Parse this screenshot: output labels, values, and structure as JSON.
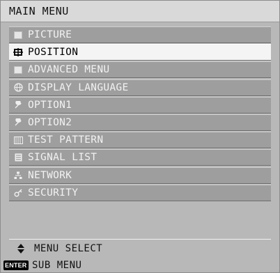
{
  "title": "MAIN MENU",
  "items": [
    {
      "label": "PICTURE",
      "icon": "picture-icon",
      "selected": false
    },
    {
      "label": "POSITION",
      "icon": "position-icon",
      "selected": true
    },
    {
      "label": "ADVANCED MENU",
      "icon": "advanced-menu-icon",
      "selected": false
    },
    {
      "label": "DISPLAY LANGUAGE",
      "icon": "globe-icon",
      "selected": false
    },
    {
      "label": "OPTION1",
      "icon": "wrench-icon",
      "selected": false
    },
    {
      "label": "OPTION2",
      "icon": "wrench-icon",
      "selected": false
    },
    {
      "label": "TEST PATTERN",
      "icon": "test-pattern-icon",
      "selected": false
    },
    {
      "label": "SIGNAL LIST",
      "icon": "signal-list-icon",
      "selected": false
    },
    {
      "label": "NETWORK",
      "icon": "network-icon",
      "selected": false
    },
    {
      "label": "SECURITY",
      "icon": "key-icon",
      "selected": false
    }
  ],
  "footer": {
    "menu_select": "MENU SELECT",
    "enter_badge": "ENTER",
    "sub_menu": "SUB MENU"
  },
  "colors": {
    "panel": "#b8b8b8",
    "item": "#9e9e9e",
    "selected_item": "#f4f4f4",
    "title_bar": "#d9d9d9"
  }
}
